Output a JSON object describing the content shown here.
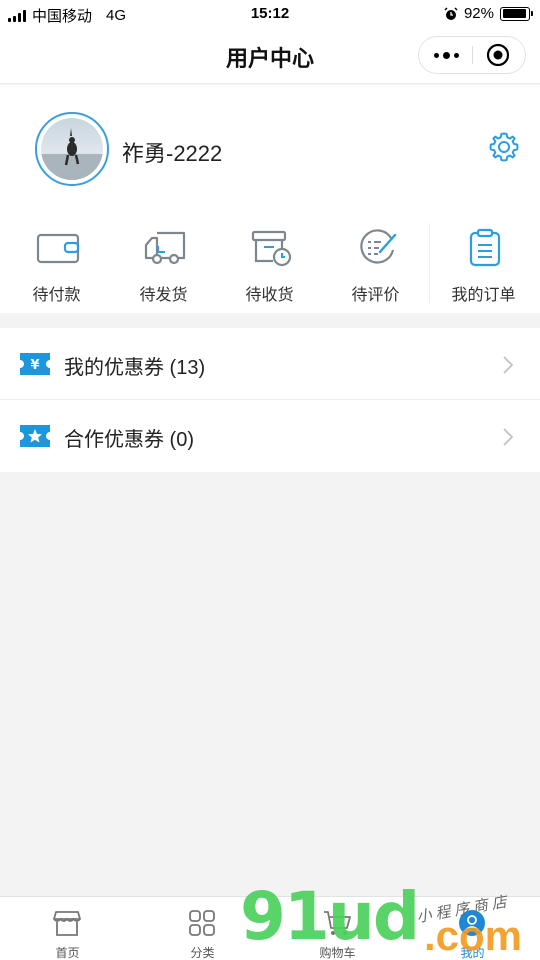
{
  "status_bar": {
    "carrier": "中国移动",
    "network": "4G",
    "time": "15:12",
    "battery_percent": "92%",
    "battery_level": 0.92
  },
  "nav": {
    "title": "用户中心"
  },
  "profile": {
    "username": "祚勇-2222"
  },
  "orders": [
    {
      "label": "待付款",
      "icon": "wallet-icon"
    },
    {
      "label": "待发货",
      "icon": "truck-icon"
    },
    {
      "label": "待收货",
      "icon": "package-clock-icon"
    },
    {
      "label": "待评价",
      "icon": "review-check-icon"
    },
    {
      "label": "我的订单",
      "icon": "clipboard-icon"
    }
  ],
  "coupons": [
    {
      "label": "我的优惠券 (13)",
      "icon": "yuan-ticket-icon"
    },
    {
      "label": "合作优惠券 (0)",
      "icon": "star-ticket-icon"
    }
  ],
  "tabbar": [
    {
      "label": "首页",
      "icon": "shop-icon",
      "active": false
    },
    {
      "label": "分类",
      "icon": "grid-icon",
      "active": false
    },
    {
      "label": "购物车",
      "icon": "cart-icon",
      "active": false
    },
    {
      "label": "我的",
      "icon": "user-icon",
      "active": true
    }
  ],
  "watermark": {
    "main": "91ud",
    "suffix": ".com",
    "sub": "小程序商店"
  },
  "colors": {
    "accent": "#1e88d8",
    "order_icon": "#7d8790",
    "order_icon_active": "#2a9ee0",
    "coupon_icon": "#1e96dc"
  }
}
